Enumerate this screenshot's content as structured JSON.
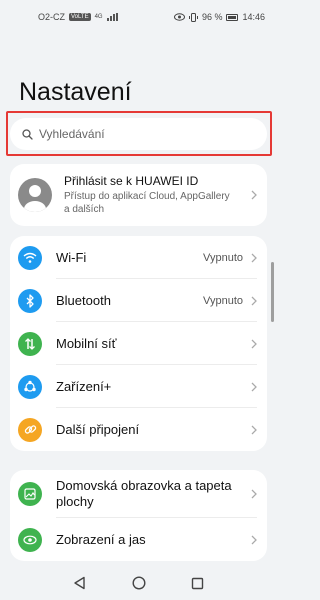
{
  "status_bar": {
    "carrier": "O2-CZ",
    "volte": "VoLTE",
    "network": "4G",
    "battery_percent": "96 %",
    "time": "14:46"
  },
  "page": {
    "title": "Nastavení"
  },
  "search": {
    "placeholder": "Vyhledávání"
  },
  "profile": {
    "title": "Přihlásit se k HUAWEI ID",
    "subtitle_line1": "Přístup do aplikací Cloud, AppGallery",
    "subtitle_line2": "a dalších"
  },
  "connectivity": [
    {
      "label": "Wi-Fi",
      "value": "Vypnuto",
      "icon": "wifi-icon",
      "color": "#1e9bf0"
    },
    {
      "label": "Bluetooth",
      "value": "Vypnuto",
      "icon": "bluetooth-icon",
      "color": "#1e9bf0"
    },
    {
      "label": "Mobilní síť",
      "value": "",
      "icon": "mobile-network-icon",
      "color": "#3fb34f"
    },
    {
      "label": "Zařízení+",
      "value": "",
      "icon": "device-plus-icon",
      "color": "#1e9bf0"
    },
    {
      "label": "Další připojení",
      "value": "",
      "icon": "link-icon",
      "color": "#f5a623"
    }
  ],
  "display": [
    {
      "label_line1": "Domovská obrazovka a tapeta",
      "label_line2": "plochy",
      "icon": "wallpaper-icon",
      "color": "#3fb34f"
    },
    {
      "label": "Zobrazení a jas",
      "icon": "eye-icon",
      "color": "#3fb34f"
    }
  ],
  "navigation": {
    "back": "back-icon",
    "home": "home-icon",
    "recents": "recents-icon"
  }
}
